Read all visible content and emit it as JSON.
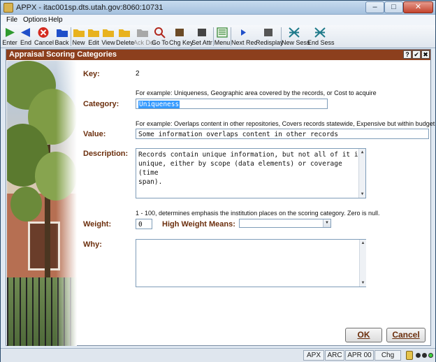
{
  "window": {
    "title": "APPX - itac001sp.dts.utah.gov:8060:10731",
    "controls": {
      "minimize": "–",
      "maximize": "□",
      "close": "✕"
    }
  },
  "menu": [
    "File",
    "Options",
    "Help"
  ],
  "toolbar": {
    "buttons": [
      {
        "label": "Enter",
        "icon": "enter-icon",
        "color": "#2e9a2e"
      },
      {
        "label": "End",
        "icon": "end-icon",
        "color": "#1f4fc9"
      },
      {
        "label": "Cancel",
        "icon": "cancel-icon",
        "color": "#d42a1f"
      },
      {
        "label": "Back",
        "icon": "back-icon",
        "color": "#1f4fc9"
      },
      {
        "label": "New",
        "icon": "new-folder-icon",
        "color": "#e8b21e"
      },
      {
        "label": "Edit",
        "icon": "edit-folder-icon",
        "color": "#e8b21e"
      },
      {
        "label": "View",
        "icon": "view-folder-icon",
        "color": "#e8b21e"
      },
      {
        "label": "Delete",
        "icon": "delete-folder-icon",
        "color": "#e8b21e"
      },
      {
        "label": "Ack Del",
        "icon": "ack-delete-icon",
        "color": "#a8a8a8",
        "disabled": true
      },
      {
        "label": "Go To",
        "icon": "goto-magnifier-icon",
        "color": "#b0261b"
      },
      {
        "label": "Chg Key",
        "icon": "change-key-icon",
        "color": "#6b4a26"
      },
      {
        "label": "Set Attr",
        "icon": "set-attribute-icon",
        "color": "#444444"
      },
      {
        "label": "Menu",
        "icon": "menu-icon",
        "color": "#3b8a3b"
      },
      {
        "label": "Next Rec",
        "icon": "next-record-icon",
        "color": "#1f4fc9"
      },
      {
        "label": "Redisplay",
        "icon": "redisplay-icon",
        "color": "#555555"
      },
      {
        "label": "New Sess",
        "icon": "new-session-icon",
        "color": "#1f7a8a"
      },
      {
        "label": "End Sess",
        "icon": "end-session-icon",
        "color": "#1f7a8a"
      }
    ]
  },
  "panel": {
    "title": "Appraisal Scoring Categories",
    "header_buttons": [
      "?",
      "✔",
      "✖"
    ]
  },
  "form": {
    "key": {
      "label": "Key:",
      "value": "2"
    },
    "category": {
      "hint": "For example: Uniqueness, Geographic area covered by the records, or Cost to acquire",
      "label": "Category:",
      "value": "Uniqueness"
    },
    "value": {
      "hint": "For example: Overlaps content in other repositories, Covers records statewide, Expensive but within budget",
      "label": "Value:",
      "value": "Some information overlaps content in other records"
    },
    "description": {
      "label": "Description:",
      "lines": [
        "Records contain unique information, but not all of it is",
        "unique, either by scope (data elements) or coverage (time",
        "span)."
      ]
    },
    "weight": {
      "hint": "1 - 100, determines emphasis the institution places on the scoring category.  Zero is null.",
      "label": "Weight:",
      "value": "0",
      "high_label": "High Weight Means:",
      "high_value": ""
    },
    "why": {
      "label": "Why:",
      "value": ""
    }
  },
  "actions": {
    "ok": "OK",
    "cancel": "Cancel"
  },
  "status": {
    "cells": [
      "APX",
      "ARC",
      "APR 00",
      "Chg"
    ]
  },
  "colors": {
    "accent": "#8c3f1d",
    "label": "#6b2e0c",
    "selection": "#3399ff"
  }
}
